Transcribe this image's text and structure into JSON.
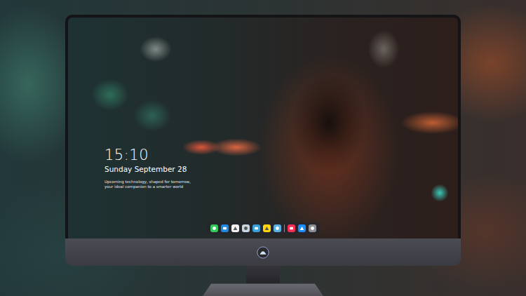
{
  "lock_screen": {
    "time": "15:10",
    "date": "Sunday September 28",
    "caption": [
      "Upcoming technology, shaped for tomorrow,",
      "your ideal companion to a smarter world"
    ]
  },
  "dock": {
    "items": [
      {
        "kind": "app",
        "color": "#34c759"
      },
      {
        "kind": "app",
        "color": "#1e88e5"
      },
      {
        "kind": "app",
        "color": "#f2f2f2"
      },
      {
        "kind": "app",
        "color": "#c9d6df"
      },
      {
        "kind": "app",
        "color": "#3aa0d8"
      },
      {
        "kind": "app",
        "color": "#ffd60a"
      },
      {
        "kind": "app",
        "color": "#5ab0e0"
      },
      {
        "kind": "separator"
      },
      {
        "kind": "app",
        "color": "#fa2d55"
      },
      {
        "kind": "app",
        "color": "#1a8cff"
      },
      {
        "kind": "app",
        "color": "#8e8e93"
      }
    ]
  }
}
